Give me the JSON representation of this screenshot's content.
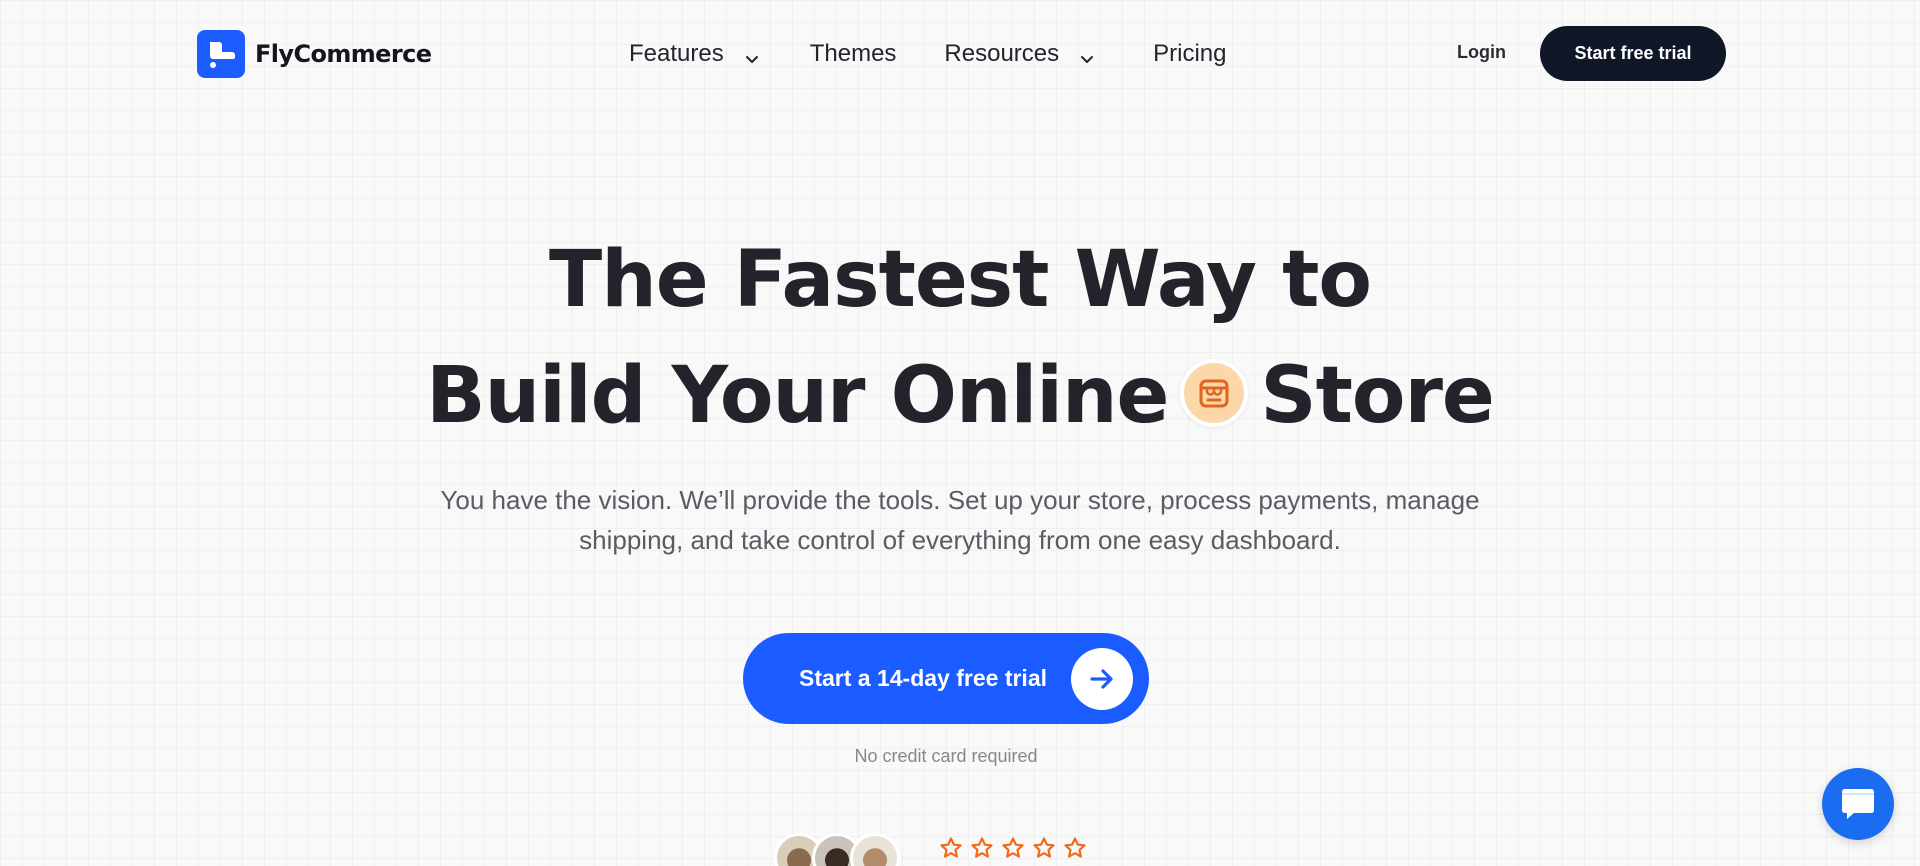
{
  "brand": {
    "name": "FlyCommerce",
    "logo_icon": "flycommerce-logo-icon",
    "accent": "#1d5cff"
  },
  "nav": {
    "items": [
      {
        "label": "Features",
        "has_dropdown": true
      },
      {
        "label": "Themes",
        "has_dropdown": false
      },
      {
        "label": "Resources",
        "has_dropdown": true
      },
      {
        "label": "Pricing",
        "has_dropdown": false
      }
    ],
    "login_label": "Login",
    "cta_label": "Start free trial"
  },
  "hero": {
    "title_line1": "The Fastest Way to",
    "title_line2_before": "Build Your Online",
    "title_line2_after": "Store",
    "badge_icon": "storefront-icon",
    "subtitle": "You have the vision. We’ll provide the tools. Set up your store, process payments, manage shipping, and take control of everything from one easy dashboard.",
    "cta_label": "Start a 14-day free trial",
    "cta_icon": "arrow-right-icon",
    "note": "No credit card required"
  },
  "social_proof": {
    "avatars": [
      "customer-avatar-1",
      "customer-avatar-2",
      "customer-avatar-3"
    ],
    "stars": 5,
    "star_color": "#f26a1b"
  },
  "chat_widget": {
    "icon": "chat-bubble-icon",
    "color": "#1a6cf0"
  }
}
